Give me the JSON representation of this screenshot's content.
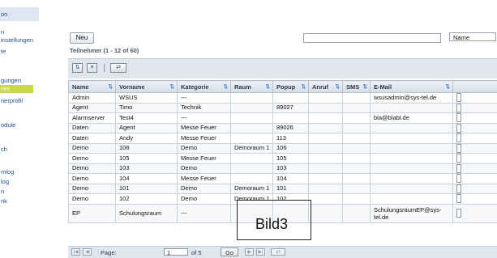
{
  "sidebar": {
    "items": [
      {
        "label": "on"
      },
      {
        "label": "n"
      },
      {
        "label": "instellungen"
      },
      {
        "label": "te"
      },
      {
        "label": "gungen"
      },
      {
        "label": "ner",
        "active": true
      },
      {
        "label": "nerprofil"
      },
      {
        "label": "odule"
      },
      {
        "label": "ch"
      },
      {
        "label": "mlog"
      },
      {
        "label": "log"
      },
      {
        "label": "n"
      },
      {
        "label": "nk"
      }
    ]
  },
  "toolbar": {
    "new_label": "Neu",
    "search_value": "",
    "field_select": "Name",
    "title": "Teilnehmer (1 - 12 of 60)"
  },
  "table": {
    "columns": [
      "Name",
      "Vorname",
      "Kategorie",
      "Raum",
      "Popup",
      "Anruf",
      "SMS",
      "E-Mail"
    ],
    "rows": [
      [
        "Admin",
        "WSUS",
        "---",
        "",
        "",
        "",
        "",
        "wsusadmin@sys-tel.de"
      ],
      [
        "Agent",
        "Timo",
        "Technik",
        "",
        "89027",
        "",
        "",
        ""
      ],
      [
        "Alarmserver",
        "Test4",
        "---",
        "",
        "",
        "",
        "",
        "bla@blabl.de"
      ],
      [
        "Daten",
        "Agent",
        "Messe Feuer",
        "",
        "89026",
        "",
        "",
        ""
      ],
      [
        "Daten",
        "Andy",
        "Messe Feuer",
        "",
        "113",
        "",
        "",
        ""
      ],
      [
        "Demo",
        "106",
        "Demo",
        "Demoraum 1",
        "106",
        "",
        "",
        ""
      ],
      [
        "Demo",
        "105",
        "Messe Feuer",
        "",
        "105",
        "",
        "",
        ""
      ],
      [
        "Demo",
        "103",
        "Demo",
        "",
        "103",
        "",
        "",
        ""
      ],
      [
        "Demo",
        "104",
        "Messe Feuer",
        "",
        "104",
        "",
        "",
        ""
      ],
      [
        "Demo",
        "101",
        "Demo",
        "Demoraum 1",
        "101",
        "",
        "",
        ""
      ],
      [
        "Demo",
        "102",
        "Demo",
        "Demoraum 1",
        "102",
        "",
        "",
        ""
      ],
      [
        "EP",
        "Schulungsraum",
        "---",
        "",
        "",
        "",
        "",
        "SchulungsraumEP@sys-tel.de"
      ]
    ]
  },
  "pager": {
    "page_label": "Page:",
    "page_value": "1",
    "of_label": "of 5",
    "go_label": "Go"
  },
  "overlay": {
    "label": "Bild3"
  }
}
